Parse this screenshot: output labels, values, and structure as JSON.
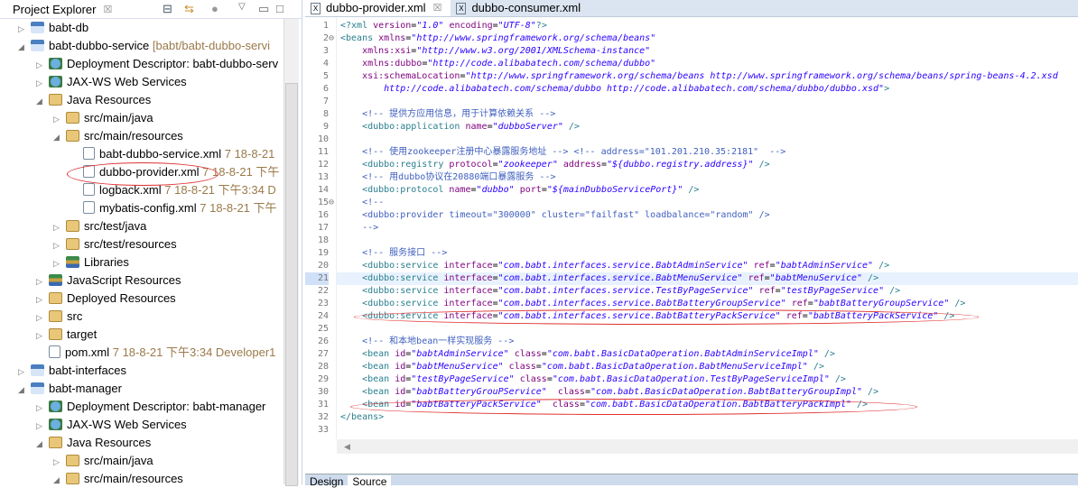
{
  "explorer": {
    "title": "Project Explorer",
    "close": "☒",
    "items": [
      {
        "label": "babt-db",
        "level": 0,
        "arrow": "▷",
        "icon": "prj"
      },
      {
        "label": "babt-dubbo-service",
        "dec": " [babt/babt-dubbo-servi",
        "level": 0,
        "arrow": "◢",
        "icon": "prj"
      },
      {
        "label": "Deployment Descriptor: babt-dubbo-serv",
        "level": 1,
        "arrow": "▷",
        "icon": "web"
      },
      {
        "label": "JAX-WS Web Services",
        "level": 1,
        "arrow": "▷",
        "icon": "web"
      },
      {
        "label": "Java Resources",
        "level": 1,
        "arrow": "◢",
        "icon": "fld"
      },
      {
        "label": "src/main/java",
        "level": 2,
        "arrow": "▷",
        "icon": "fld"
      },
      {
        "label": "src/main/resources",
        "level": 2,
        "arrow": "◢",
        "icon": "fld"
      },
      {
        "label": "babt-dubbo-service.xml",
        "dec": " 7  18-8-21",
        "level": 3,
        "arrow": "",
        "icon": "xml"
      },
      {
        "label": "dubbo-provider.xml",
        "dec": " 7  18-8-21 下午",
        "level": 3,
        "arrow": "",
        "icon": "xml"
      },
      {
        "label": "logback.xml",
        "dec": " 7  18-8-21 下午3:34  D",
        "level": 3,
        "arrow": "",
        "icon": "xml"
      },
      {
        "label": "mybatis-config.xml",
        "dec": " 7  18-8-21 下午",
        "level": 3,
        "arrow": "",
        "icon": "xml"
      },
      {
        "label": "src/test/java",
        "level": 2,
        "arrow": "▷",
        "icon": "fld"
      },
      {
        "label": "src/test/resources",
        "level": 2,
        "arrow": "▷",
        "icon": "fld"
      },
      {
        "label": "Libraries",
        "level": 2,
        "arrow": "▷",
        "icon": "lib"
      },
      {
        "label": "JavaScript Resources",
        "level": 1,
        "arrow": "▷",
        "icon": "lib"
      },
      {
        "label": "Deployed Resources",
        "level": 1,
        "arrow": "▷",
        "icon": "fld"
      },
      {
        "label": "src",
        "level": 1,
        "arrow": "▷",
        "icon": "fld"
      },
      {
        "label": "target",
        "level": 1,
        "arrow": "▷",
        "icon": "fld"
      },
      {
        "label": "pom.xml",
        "dec": " 7  18-8-21 下午3:34  Developer1",
        "level": 1,
        "arrow": "",
        "icon": "xml"
      },
      {
        "label": "babt-interfaces",
        "level": 0,
        "arrow": "▷",
        "icon": "prj"
      },
      {
        "label": "babt-manager",
        "level": 0,
        "arrow": "◢",
        "icon": "prj"
      },
      {
        "label": "Deployment Descriptor: babt-manager",
        "level": 1,
        "arrow": "▷",
        "icon": "web"
      },
      {
        "label": "JAX-WS Web Services",
        "level": 1,
        "arrow": "▷",
        "icon": "web"
      },
      {
        "label": "Java Resources",
        "level": 1,
        "arrow": "◢",
        "icon": "fld"
      },
      {
        "label": "src/main/java",
        "level": 2,
        "arrow": "▷",
        "icon": "fld"
      },
      {
        "label": "src/main/resources",
        "level": 2,
        "arrow": "◢",
        "icon": "fld"
      }
    ]
  },
  "editor": {
    "tabs": [
      {
        "label": "dubbo-provider.xml",
        "close": "☒"
      },
      {
        "label": "dubbo-consumer.xml"
      }
    ],
    "bottom_tabs": [
      "Design",
      "Source"
    ],
    "highlighted_line": 21,
    "lines": [
      [
        [
          "tag",
          "<?xml "
        ],
        [
          "attr",
          "version"
        ],
        [
          "pl",
          "="
        ],
        [
          "val",
          "\"1.0\""
        ],
        [
          "attr",
          " encoding"
        ],
        [
          "pl",
          "="
        ],
        [
          "val",
          "\"UTF-8\""
        ],
        [
          "tag",
          "?>"
        ]
      ],
      [
        [
          "tag",
          "<beans "
        ],
        [
          "attr",
          "xmlns"
        ],
        [
          "pl",
          "="
        ],
        [
          "val",
          "\"http://www.springframework.org/schema/beans\""
        ]
      ],
      [
        [
          "attr",
          "    xmlns:xsi"
        ],
        [
          "pl",
          "="
        ],
        [
          "val",
          "\"http://www.w3.org/2001/XMLSchema-instance\""
        ]
      ],
      [
        [
          "attr",
          "    xmlns:dubbo"
        ],
        [
          "pl",
          "="
        ],
        [
          "val",
          "\"http://code.alibabatech.com/schema/dubbo\""
        ]
      ],
      [
        [
          "attr",
          "    xsi:schemaLocation"
        ],
        [
          "pl",
          "="
        ],
        [
          "val",
          "\"http://www.springframework.org/schema/beans http://www.springframework.org/schema/beans/spring-beans-4.2.xsd"
        ]
      ],
      [
        [
          "val",
          "        http://code.alibabatech.com/schema/dubbo http://code.alibabatech.com/schema/dubbo/dubbo.xsd\""
        ],
        [
          "tag",
          ">"
        ]
      ],
      [],
      [
        [
          "cm",
          "    <!-- 提供方应用信息，用于计算依赖关系 -->"
        ]
      ],
      [
        [
          "tag",
          "    <dubbo:application "
        ],
        [
          "attr",
          "name"
        ],
        [
          "pl",
          "="
        ],
        [
          "val",
          "\"dubboServer\""
        ],
        [
          "tag",
          " />"
        ]
      ],
      [],
      [
        [
          "cm",
          "    <!-- 使用zookeeper注册中心暴露服务地址 --> <!-- address=\"101.201.210.35:2181\"  -->"
        ]
      ],
      [
        [
          "tag",
          "    <dubbo:registry "
        ],
        [
          "attr",
          "protocol"
        ],
        [
          "pl",
          "="
        ],
        [
          "val",
          "\"zookeeper\""
        ],
        [
          "attr",
          " address"
        ],
        [
          "pl",
          "="
        ],
        [
          "val",
          "\"${dubbo.registry.address}\""
        ],
        [
          "tag",
          " />"
        ]
      ],
      [
        [
          "cm",
          "    <!-- 用dubbo协议在20880端口暴露服务 -->"
        ]
      ],
      [
        [
          "tag",
          "    <dubbo:protocol "
        ],
        [
          "attr",
          "name"
        ],
        [
          "pl",
          "="
        ],
        [
          "val",
          "\"dubbo\""
        ],
        [
          "attr",
          " port"
        ],
        [
          "pl",
          "="
        ],
        [
          "val",
          "\"${mainDubboServicePort}\""
        ],
        [
          "tag",
          " />"
        ]
      ],
      [
        [
          "cm",
          "    <!--"
        ]
      ],
      [
        [
          "cm",
          "    <dubbo:provider timeout=\"300000\" cluster=\"failfast\" loadbalance=\"random\" />"
        ]
      ],
      [
        [
          "cm",
          "    -->"
        ]
      ],
      [],
      [
        [
          "cm",
          "    <!-- 服务接口 -->"
        ]
      ],
      [
        [
          "tag",
          "    <dubbo:service "
        ],
        [
          "attr",
          "interface"
        ],
        [
          "pl",
          "="
        ],
        [
          "val",
          "\"com.babt.interfaces.service.BabtAdminService\""
        ],
        [
          "attr",
          " ref"
        ],
        [
          "pl",
          "="
        ],
        [
          "val",
          "\"babtAdminService\""
        ],
        [
          "tag",
          " />"
        ]
      ],
      [
        [
          "tag",
          "    <dubbo:service "
        ],
        [
          "attr",
          "interface"
        ],
        [
          "pl",
          "="
        ],
        [
          "val",
          "\"com.babt.interfaces.service.BabtMenuService\""
        ],
        [
          "attr",
          " ref"
        ],
        [
          "pl",
          "="
        ],
        [
          "val",
          "\"babtMenuService\""
        ],
        [
          "tag",
          " />"
        ]
      ],
      [
        [
          "tag",
          "    <dubbo:service "
        ],
        [
          "attr",
          "interface"
        ],
        [
          "pl",
          "="
        ],
        [
          "val",
          "\"com.babt.interfaces.service.TestByPageService\""
        ],
        [
          "attr",
          " ref"
        ],
        [
          "pl",
          "="
        ],
        [
          "val",
          "\"testByPageService\""
        ],
        [
          "tag",
          " />"
        ]
      ],
      [
        [
          "tag",
          "    <dubbo:service "
        ],
        [
          "attr",
          "interface"
        ],
        [
          "pl",
          "="
        ],
        [
          "val",
          "\"com.babt.interfaces.service.BabtBatteryGroupService\""
        ],
        [
          "attr",
          " ref"
        ],
        [
          "pl",
          "="
        ],
        [
          "val",
          "\"babtBatteryGroupService\""
        ],
        [
          "tag",
          " />"
        ]
      ],
      [
        [
          "tag",
          "    <dubbo:service "
        ],
        [
          "attr",
          "interface"
        ],
        [
          "pl",
          "="
        ],
        [
          "val",
          "\"com.babt.interfaces.service.BabtBatteryPackService\""
        ],
        [
          "attr",
          " ref"
        ],
        [
          "pl",
          "="
        ],
        [
          "val",
          "\"babtBatteryPackService\""
        ],
        [
          "tag",
          " />"
        ]
      ],
      [],
      [
        [
          "cm",
          "    <!-- 和本地bean一样实现服务 -->"
        ]
      ],
      [
        [
          "tag",
          "    <bean "
        ],
        [
          "attr",
          "id"
        ],
        [
          "pl",
          "="
        ],
        [
          "val",
          "\"babtAdminService\""
        ],
        [
          "attr",
          " class"
        ],
        [
          "pl",
          "="
        ],
        [
          "val",
          "\"com.babt.BasicDataOperation.BabtAdminServiceImpl\""
        ],
        [
          "tag",
          " />"
        ]
      ],
      [
        [
          "tag",
          "    <bean "
        ],
        [
          "attr",
          "id"
        ],
        [
          "pl",
          "="
        ],
        [
          "val",
          "\"babtMenuService\""
        ],
        [
          "attr",
          " class"
        ],
        [
          "pl",
          "="
        ],
        [
          "val",
          "\"com.babt.BasicDataOperation.BabtMenuServiceImpl\""
        ],
        [
          "tag",
          " />"
        ]
      ],
      [
        [
          "tag",
          "    <bean "
        ],
        [
          "attr",
          "id"
        ],
        [
          "pl",
          "="
        ],
        [
          "val",
          "\"testByPageService\""
        ],
        [
          "attr",
          " class"
        ],
        [
          "pl",
          "="
        ],
        [
          "val",
          "\"com.babt.BasicDataOperation.TestByPageServiceImpl\""
        ],
        [
          "tag",
          " />"
        ]
      ],
      [
        [
          "tag",
          "    <bean "
        ],
        [
          "attr",
          "id"
        ],
        [
          "pl",
          "="
        ],
        [
          "val",
          "\"babtBatteryGrouPService\""
        ],
        [
          "attr",
          "  class"
        ],
        [
          "pl",
          "="
        ],
        [
          "val",
          "\"com.babt.BasicDataOperation.BabtBatteryGroupImpl\""
        ],
        [
          "tag",
          " />"
        ]
      ],
      [
        [
          "tag",
          "    <bean "
        ],
        [
          "attr",
          "id"
        ],
        [
          "pl",
          "="
        ],
        [
          "val",
          "\"babtBatteryPackService\""
        ],
        [
          "attr",
          "  class"
        ],
        [
          "pl",
          "="
        ],
        [
          "val",
          "\"com.babt.BasicDataOperation.BabtBatteryPackImpl\""
        ],
        [
          "tag",
          " />"
        ]
      ],
      [
        [
          "tag",
          "</beans>"
        ]
      ],
      []
    ]
  }
}
